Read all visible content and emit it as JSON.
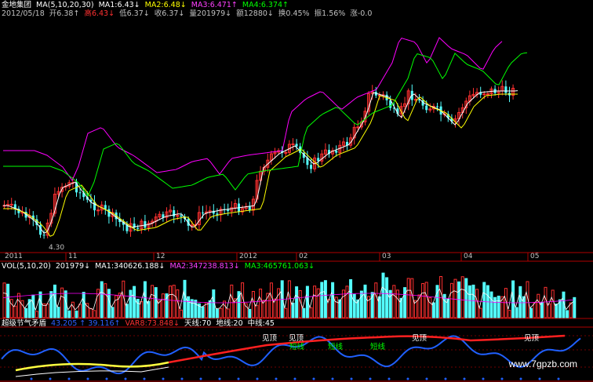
{
  "header": {
    "stock_name": "金地集团",
    "ma_label": "MA(5,10,20,30)",
    "ma1": "MA1:6.43↓",
    "ma2": "MA2:6.48↓",
    "ma3": "MA3:6.471↑",
    "ma4": "MA4:6.374↑",
    "date": "2012/05/18",
    "open": "开6.38↑",
    "high": "高6.43↓",
    "low": "低6.37↓",
    "close": "收6.37↓",
    "volume": "量201979↓",
    "amount": "额12880↓",
    "turnover": "换0.45%",
    "amplitude": "振1.56%",
    "change": "涨-0.0"
  },
  "price_panel": {
    "low_marker": "4.30",
    "x_labels": [
      "2011",
      "11",
      "12",
      "2012",
      "02",
      "03",
      "04",
      "05"
    ]
  },
  "volume_panel": {
    "label": "VOL(5,10,20)",
    "vol": "201979↓",
    "ma1": "MA1:340626.188↓",
    "ma2": "MA2:347238.813↓",
    "ma3": "MA3:465761.063↓"
  },
  "indicator_panel": {
    "name": "超级节气矛盾",
    "var1": "43.205 ↑ 39.116↑",
    "var8": "VAR8:73.848↓",
    "sky": "天线:70",
    "ground": "地线:20",
    "mid": "中线:45",
    "markers": [
      {
        "text": "见顶",
        "color": "#ffffff"
      },
      {
        "text": "见顶",
        "color": "#ffffff"
      },
      {
        "text": "短线",
        "color": "#00ff00"
      },
      {
        "text": "短线",
        "color": "#00ff00"
      },
      {
        "text": "短线",
        "color": "#00ff00"
      },
      {
        "text": "见顶",
        "color": "#ffffff"
      },
      {
        "text": "见顶",
        "color": "#ffffff"
      }
    ]
  },
  "watermark": "www.7gpzb.com",
  "colors": {
    "up": "#ff3030",
    "down": "#54ffff",
    "ma1": "#ffffff",
    "ma2": "#ffff00",
    "ma3": "#ff00ff",
    "ma4": "#00ff00",
    "axis": "#b00000"
  }
}
